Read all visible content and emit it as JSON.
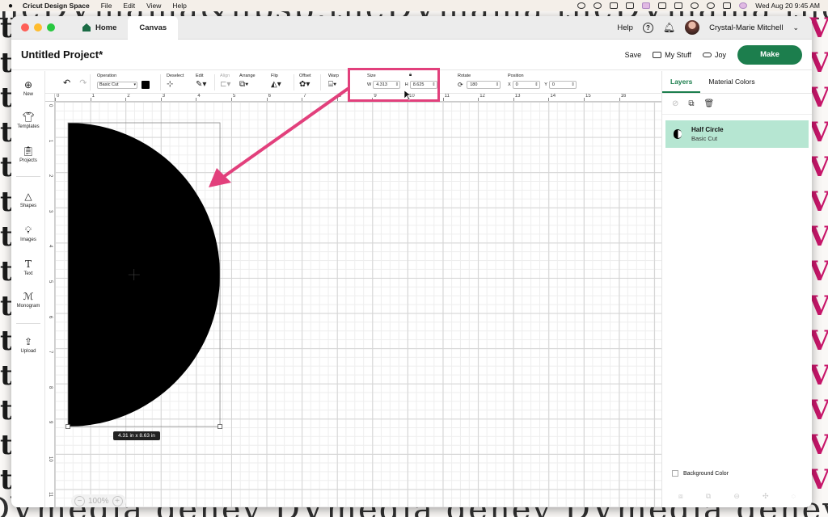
{
  "menubar": {
    "app_name": "Cricut Design Space",
    "menus": [
      "File",
      "Edit",
      "View",
      "Help"
    ],
    "datetime": "Wed Aug 20  9:45 AM"
  },
  "titlebar": {
    "tabs": [
      {
        "label": "Home"
      },
      {
        "label": "Canvas"
      }
    ],
    "help_label": "Help",
    "user_name": "Crystal-Marie Mitchell"
  },
  "project": {
    "title": "Untitled Project*",
    "save_label": "Save",
    "mystuff_label": "My Stuff",
    "machine_label": "Joy",
    "make_label": "Make"
  },
  "sidebar": {
    "items": [
      {
        "label": "New",
        "icon": "plus-icon"
      },
      {
        "label": "Templates",
        "icon": "shirt-icon"
      },
      {
        "label": "Projects",
        "icon": "clipboard-icon"
      },
      {
        "label": "Shapes",
        "icon": "shapes-icon"
      },
      {
        "label": "Images",
        "icon": "bulb-icon"
      },
      {
        "label": "Text",
        "icon": "text-icon"
      },
      {
        "label": "Monogram",
        "icon": "monogram-icon"
      },
      {
        "label": "Upload",
        "icon": "upload-icon"
      }
    ]
  },
  "toolbar": {
    "operation_label": "Operation",
    "operation_value": "Basic Cut",
    "deselect_label": "Deselect",
    "edit_label": "Edit",
    "align_label": "Align",
    "arrange_label": "Arrange",
    "flip_label": "Flip",
    "offset_label": "Offset",
    "warp_label": "Warp",
    "size_label": "Size",
    "width_axis": "W",
    "width_value": "4.313",
    "height_axis": "H",
    "height_value": "8.625",
    "rotate_label": "Rotate",
    "rotate_value": "180",
    "position_label": "Position",
    "x_axis": "X",
    "x_value": "0",
    "y_axis": "Y",
    "y_value": "0"
  },
  "panel": {
    "tabs": [
      "Layers",
      "Material Colors"
    ],
    "layer_name": "Half Circle",
    "layer_sub": "Basic Cut",
    "background_label": "Background Color"
  },
  "canvas": {
    "ruler_top": [
      "0",
      "1",
      "2",
      "3",
      "4",
      "5",
      "6",
      "7",
      "8",
      "9",
      "10",
      "11",
      "12",
      "13",
      "14",
      "15",
      "16"
    ],
    "ruler_left": [
      "0",
      "1",
      "2",
      "3",
      "4",
      "5",
      "6",
      "7",
      "8",
      "9",
      "10",
      "11"
    ],
    "size_tooltip": "4.31  in x 8.63  in",
    "zoom_level": "100%",
    "shape_fill": "#000000"
  },
  "annotation_color": "#e2407c",
  "accent_color": "#1c7e4d"
}
